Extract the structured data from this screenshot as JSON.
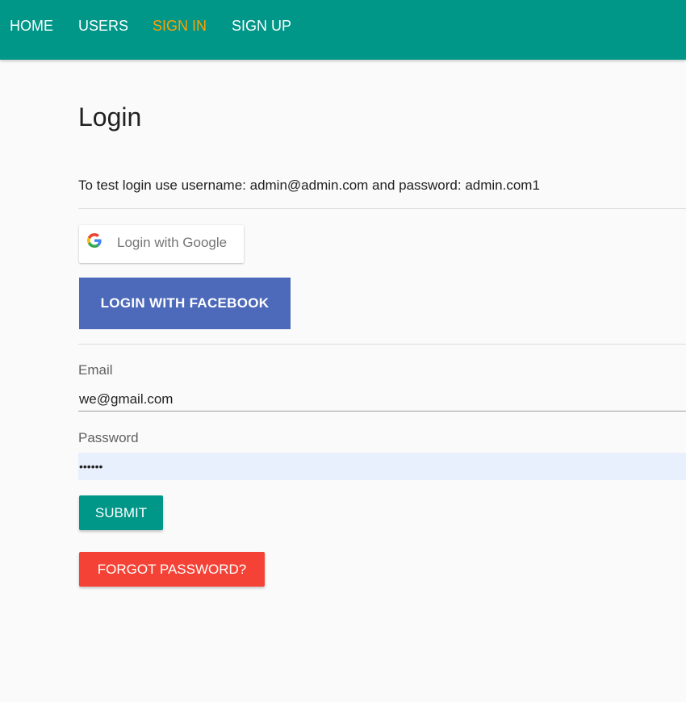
{
  "nav": {
    "items": [
      {
        "label": "HOME",
        "active": false
      },
      {
        "label": "USERS",
        "active": false
      },
      {
        "label": "SIGN IN",
        "active": true
      },
      {
        "label": "SIGN UP",
        "active": false
      }
    ]
  },
  "page": {
    "title": "Login",
    "hint": "To test login use username: admin@admin.com and password: admin.com1"
  },
  "social": {
    "google_label": "Login with Google",
    "facebook_label": "LOGIN WITH FACEBOOK"
  },
  "form": {
    "email_label": "Email",
    "email_value": "we@gmail.com",
    "password_label": "Password",
    "password_value": "••••••",
    "submit_label": "SUBMIT",
    "forgot_label": "FORGOT PASSWORD?"
  },
  "colors": {
    "navbar": "#009688",
    "nav_active": "#ffa000",
    "facebook": "#4c69ba",
    "submit": "#009688",
    "forgot": "#f44336",
    "autofill": "#e8f0fe"
  },
  "icons": {
    "google": "google-g-icon"
  }
}
